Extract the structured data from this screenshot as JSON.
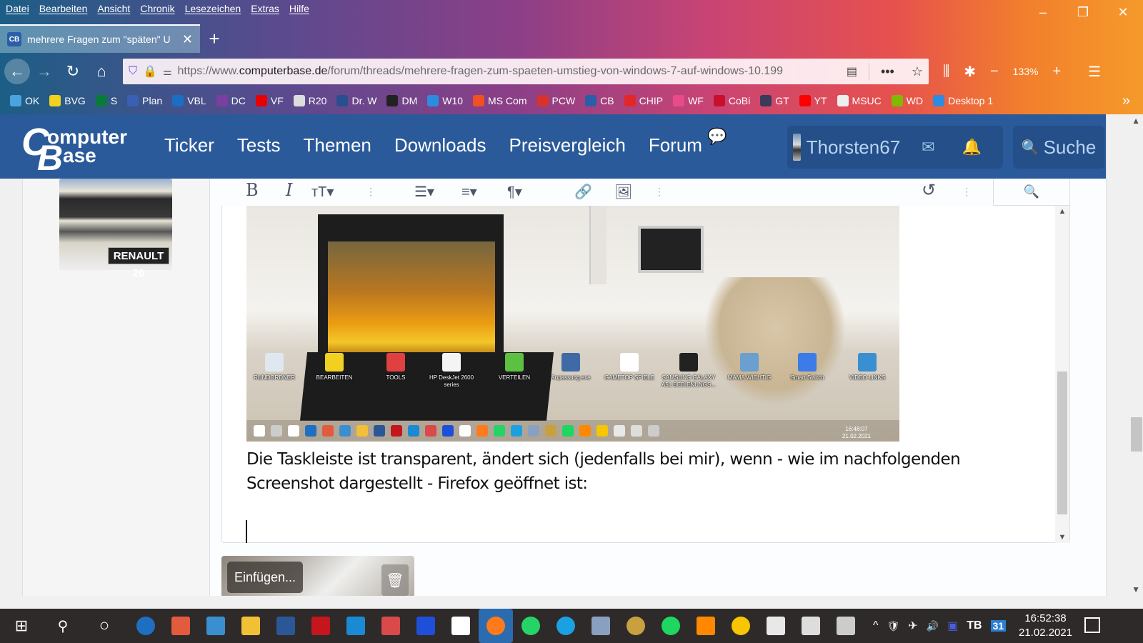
{
  "browser": {
    "menu": [
      "Datei",
      "Bearbeiten",
      "Ansicht",
      "Chronik",
      "Lesezeichen",
      "Extras",
      "Hilfe"
    ],
    "window_controls": {
      "minimize": "–",
      "restore": "❐",
      "close": "✕"
    },
    "tab": {
      "favicon": "CB",
      "title": "mehrere Fragen zum \"späten\" U",
      "close": "✕"
    },
    "new_tab": "+",
    "nav": {
      "back": "←",
      "forward": "→",
      "reload": "↻",
      "home": "⌂"
    },
    "url": {
      "prefix": "https://www.",
      "domain": "computerbase.de",
      "path": "/forum/threads/mehrere-fragen-zum-spaeten-umstieg-von-windows-7-auf-windows-10.199"
    },
    "url_icons": {
      "shield": "⛉",
      "lock": "🔒",
      "permissions": "⚌",
      "reader": "▤",
      "more": "•••",
      "bookmark": "☆"
    },
    "right_nav": {
      "library": "⫼",
      "extensions": "✱",
      "zoom_out": "−",
      "zoom_level": "133%",
      "zoom_in": "+",
      "menu": "☰"
    },
    "bookmarks": [
      {
        "label": "OK",
        "color": "#4aa3df"
      },
      {
        "label": "BVG",
        "color": "#f2d31b"
      },
      {
        "label": "S",
        "color": "#0a7a3a"
      },
      {
        "label": "Plan",
        "color": "#3b5fb5"
      },
      {
        "label": "VBL",
        "color": "#1a6fc4"
      },
      {
        "label": "DC",
        "color": "#7a3fa0"
      },
      {
        "label": "VF",
        "color": "#e60000"
      },
      {
        "label": "R20",
        "color": "#dddddd"
      },
      {
        "label": "Dr. W",
        "color": "#2a4f8f"
      },
      {
        "label": "DM",
        "color": "#222222"
      },
      {
        "label": "W10",
        "color": "#2d8be0"
      },
      {
        "label": "MS Com",
        "color": "#f25022"
      },
      {
        "label": "PCW",
        "color": "#d9322e"
      },
      {
        "label": "CB",
        "color": "#2a5ea8"
      },
      {
        "label": "CHIP",
        "color": "#e32727"
      },
      {
        "label": "WF",
        "color": "#e94b8a"
      },
      {
        "label": "CoBi",
        "color": "#c8102e"
      },
      {
        "label": "GT",
        "color": "#3a3a5a"
      },
      {
        "label": "YT",
        "color": "#ff0000"
      },
      {
        "label": "MSUC",
        "color": "#eeeeee"
      },
      {
        "label": "WD",
        "color": "#7fba00"
      },
      {
        "label": "Desktop 1",
        "color": "#2d8be0"
      }
    ],
    "bookmarks_more": "»"
  },
  "site": {
    "logo": {
      "c": "C",
      "line1": "omputer",
      "b": "B",
      "line2": "ase"
    },
    "nav": [
      "Ticker",
      "Tests",
      "Themen",
      "Downloads",
      "Preisvergleich",
      "Forum"
    ],
    "forum_icon": "💬",
    "username": "Thorsten67",
    "mail_icon": "✉",
    "bell_icon": "🔔",
    "search_icon": "🔍",
    "search_label": "Suche"
  },
  "avatar": {
    "plate": "RENAULT 20"
  },
  "editor": {
    "toolbar": {
      "bold": "B",
      "italic": "I",
      "text_size": "тT▾",
      "more1": "⋮",
      "list": "☰▾",
      "align": "≡▾",
      "paragraph": "¶▾",
      "link": "🔗",
      "image": "🖼",
      "more2": "⋮",
      "undo": "↺",
      "more3": "⋮",
      "preview": "🔍"
    },
    "text": "Die Taskleiste ist transparent, ändert sich (jedenfalls bei mir), wenn - wie im nachfolgenden Screenshot dargestellt - Firefox geöffnet ist:",
    "embedded_screenshot": {
      "desktop_icons": [
        {
          "label": "RUNDORDNER",
          "color": "#dfe8f0"
        },
        {
          "label": "BEARBEITEN",
          "color": "#f0d020"
        },
        {
          "label": "TOOLS",
          "color": "#e04040"
        },
        {
          "label": "HP DeskJet 2600 series",
          "color": "#f4f4f4"
        },
        {
          "label": "VERTEILEN",
          "color": "#5cc040"
        },
        {
          "label": "Anpassung.exe",
          "color": "#3f6aa5"
        },
        {
          "label": "GAMETOP SPIELE",
          "color": "#ffffff"
        },
        {
          "label": "SAMSUNG GALAXY A51 BEDIENUNGS...",
          "color": "#222222"
        },
        {
          "label": "MAMA WICHTIG",
          "color": "#6a9fd0"
        },
        {
          "label": "Smart Switch",
          "color": "#3d7be8"
        },
        {
          "label": "VIDEO-LINKS",
          "color": "#3a8fd0"
        }
      ],
      "taskbar_clock": {
        "time": "16:48:07",
        "date": "21.02.2021"
      }
    }
  },
  "attachment": {
    "insert_label": "Einfügen...",
    "delete_icon": "🗑"
  },
  "taskbar": {
    "start": "⊞",
    "search": "⚲",
    "cortana": "○",
    "apps": [
      {
        "name": "power-app",
        "color": "#1e6fc2"
      },
      {
        "name": "shutdown-app",
        "color": "#e35b3f"
      },
      {
        "name": "control-panel",
        "color": "#3a8fd0"
      },
      {
        "name": "file-explorer",
        "color": "#f2c036"
      },
      {
        "name": "word",
        "color": "#2b5797"
      },
      {
        "name": "acrobat",
        "color": "#c4161c"
      },
      {
        "name": "mail",
        "color": "#1a8ad4"
      },
      {
        "name": "paint",
        "color": "#d94a4a"
      },
      {
        "name": "malwarebytes",
        "color": "#1d4fd8"
      },
      {
        "name": "defender",
        "color": "#ffffff"
      },
      {
        "name": "firefox",
        "color": "#ff7a1a"
      },
      {
        "name": "whatsapp",
        "color": "#25d366"
      },
      {
        "name": "skype",
        "color": "#1ba1e2"
      },
      {
        "name": "recycle-tool",
        "color": "#8aa0c0"
      },
      {
        "name": "disc-app",
        "color": "#c9a040"
      },
      {
        "name": "spotify",
        "color": "#1ed760"
      },
      {
        "name": "vlc",
        "color": "#ff8800"
      },
      {
        "name": "aimp",
        "color": "#f7c600"
      },
      {
        "name": "skat",
        "color": "#e8e8e8"
      },
      {
        "name": "solitaire",
        "color": "#dddddd"
      },
      {
        "name": "dice",
        "color": "#cccccc"
      }
    ],
    "tray": {
      "chevron": "^",
      "security": "🛡",
      "airplane": "✈",
      "volume": "🔊",
      "app1": "▣",
      "app2": "TB",
      "calendar": "31"
    },
    "clock": {
      "time": "16:52:38",
      "date": "21.02.2021"
    }
  }
}
